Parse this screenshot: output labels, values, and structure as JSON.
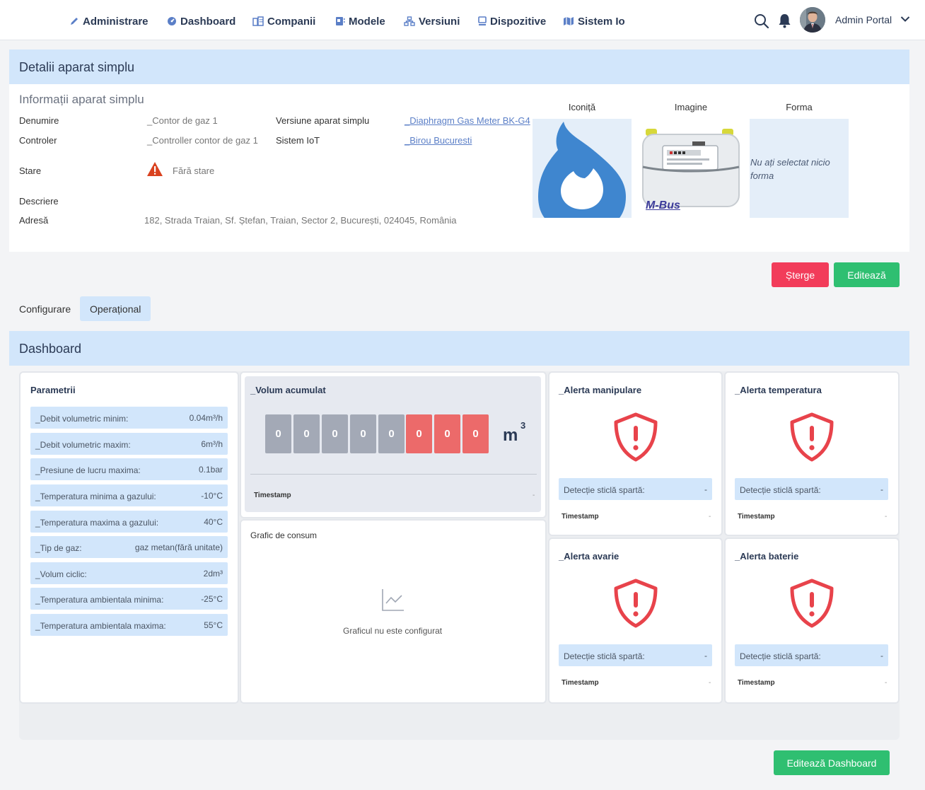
{
  "nav": {
    "items": [
      {
        "label": "Administrare",
        "icon": "pencil-icon"
      },
      {
        "label": "Dashboard",
        "icon": "dashboard-icon"
      },
      {
        "label": "Companii",
        "icon": "buildings-icon"
      },
      {
        "label": "Modele",
        "icon": "book-icon"
      },
      {
        "label": "Versiuni",
        "icon": "sitemap-icon"
      },
      {
        "label": "Dispozitive",
        "icon": "monitor-icon"
      },
      {
        "label": "Sistem Io",
        "icon": "map-icon"
      }
    ],
    "user_name": "Admin Portal"
  },
  "details": {
    "header": "Detalii aparat simplu",
    "info_title": "Informații aparat simplu",
    "fields": {
      "denumire_label": "Denumire",
      "denumire_value": "_Contor de gaz 1",
      "controler_label": "Controler",
      "controler_value": "_Controller contor de gaz 1",
      "stare_label": "Stare",
      "stare_value": "Fără stare",
      "descriere_label": "Descriere",
      "adresa_label": "Adresă",
      "adresa_value": "182, Strada Traian, Sf. Ștefan, Traian, Sector 2, București, 024045, România",
      "versiune_label": "Versiune aparat simplu",
      "versiune_value": "_Diaphragm Gas Meter BK-G4",
      "sistem_label": "Sistem IoT",
      "sistem_value": "_Birou Bucuresti"
    },
    "media": {
      "icon_title": "Iconiță",
      "image_title": "Imagine",
      "form_title": "Forma",
      "no_form_text": "Nu ați selectat nicio forma",
      "mbus_text": "M-Bus"
    },
    "buttons": {
      "delete": "Șterge",
      "edit": "Editează"
    }
  },
  "tabs": [
    {
      "label": "Configurare",
      "active": false
    },
    {
      "label": "Operațional",
      "active": true
    }
  ],
  "dashboard": {
    "header": "Dashboard",
    "parameters": {
      "title": "Parametrii",
      "rows": [
        {
          "label": "_Debit volumetric minim:",
          "value": "0.04m³/h"
        },
        {
          "label": "_Debit volumetric maxim:",
          "value": "6m³/h"
        },
        {
          "label": "_Presiune de lucru maxima:",
          "value": "0.1bar"
        },
        {
          "label": "_Temperatura minima a gazului:",
          "value": "-10°C"
        },
        {
          "label": "_Temperatura maxima a gazului:",
          "value": "40°C"
        },
        {
          "label": "_Tip de gaz:",
          "value": "gaz metan(fără unitate)"
        },
        {
          "label": "_Volum ciclic:",
          "value": "2dm³"
        },
        {
          "label": "_Temperatura ambientala minima:",
          "value": "-25°C"
        },
        {
          "label": "_Temperatura ambientala maxima:",
          "value": "55°C"
        }
      ]
    },
    "volume": {
      "title": "_Volum acumulat",
      "digits": [
        "0",
        "0",
        "0",
        "0",
        "0",
        "0",
        "0",
        "0"
      ],
      "unit": "m",
      "unit_sup": "3",
      "timestamp_label": "Timestamp",
      "timestamp_value": "-"
    },
    "chart": {
      "title": "Grafic de consum",
      "empty_text": "Graficul nu este configurat"
    },
    "alerts": [
      {
        "title": "_Alerta manipulare",
        "row_label": "Detecție sticlă spartă:",
        "row_value": "-",
        "timestamp_label": "Timestamp",
        "timestamp_value": "-"
      },
      {
        "title": "_Alerta temperatura",
        "row_label": "Detecție sticlă spartă:",
        "row_value": "-",
        "timestamp_label": "Timestamp",
        "timestamp_value": "-"
      },
      {
        "title": "_Alerta avarie",
        "row_label": "Detecție sticlă spartă:",
        "row_value": "-",
        "timestamp_label": "Timestamp",
        "timestamp_value": "-"
      },
      {
        "title": "_Alerta baterie",
        "row_label": "Detecție sticlă spartă:",
        "row_value": "-",
        "timestamp_label": "Timestamp",
        "timestamp_value": "-"
      }
    ],
    "edit_button": "Editează Dashboard"
  },
  "colors": {
    "accent_blue": "#d2e6fb",
    "danger": "#f23c5a",
    "success": "#2fbf71",
    "alert_red": "#e8434b",
    "flame_blue": "#3f86cf"
  }
}
